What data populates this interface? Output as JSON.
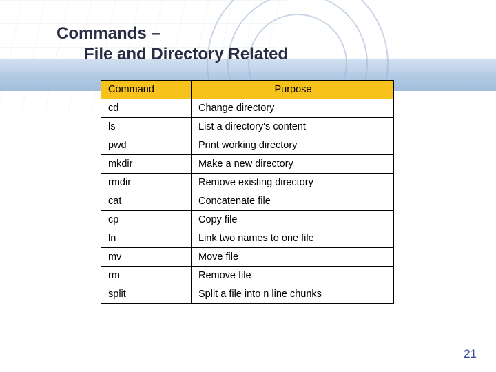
{
  "title": {
    "line1": "Commands –",
    "line2": "File and Directory Related"
  },
  "table": {
    "headers": {
      "command": "Command",
      "purpose": "Purpose"
    },
    "rows": [
      {
        "command": "cd",
        "purpose": "Change directory"
      },
      {
        "command": "ls",
        "purpose": "List a directory's content"
      },
      {
        "command": "pwd",
        "purpose": "Print working directory"
      },
      {
        "command": "mkdir",
        "purpose": "Make a new directory"
      },
      {
        "command": "rmdir",
        "purpose": "Remove existing directory"
      },
      {
        "command": "cat",
        "purpose": "Concatenate file"
      },
      {
        "command": "cp",
        "purpose": "Copy file"
      },
      {
        "command": "ln",
        "purpose": "Link two names to one file"
      },
      {
        "command": "mv",
        "purpose": "Move file"
      },
      {
        "command": "rm",
        "purpose": "Remove file"
      },
      {
        "command": "split",
        "purpose": "Split a file into n line chunks"
      }
    ]
  },
  "page_number": "21"
}
